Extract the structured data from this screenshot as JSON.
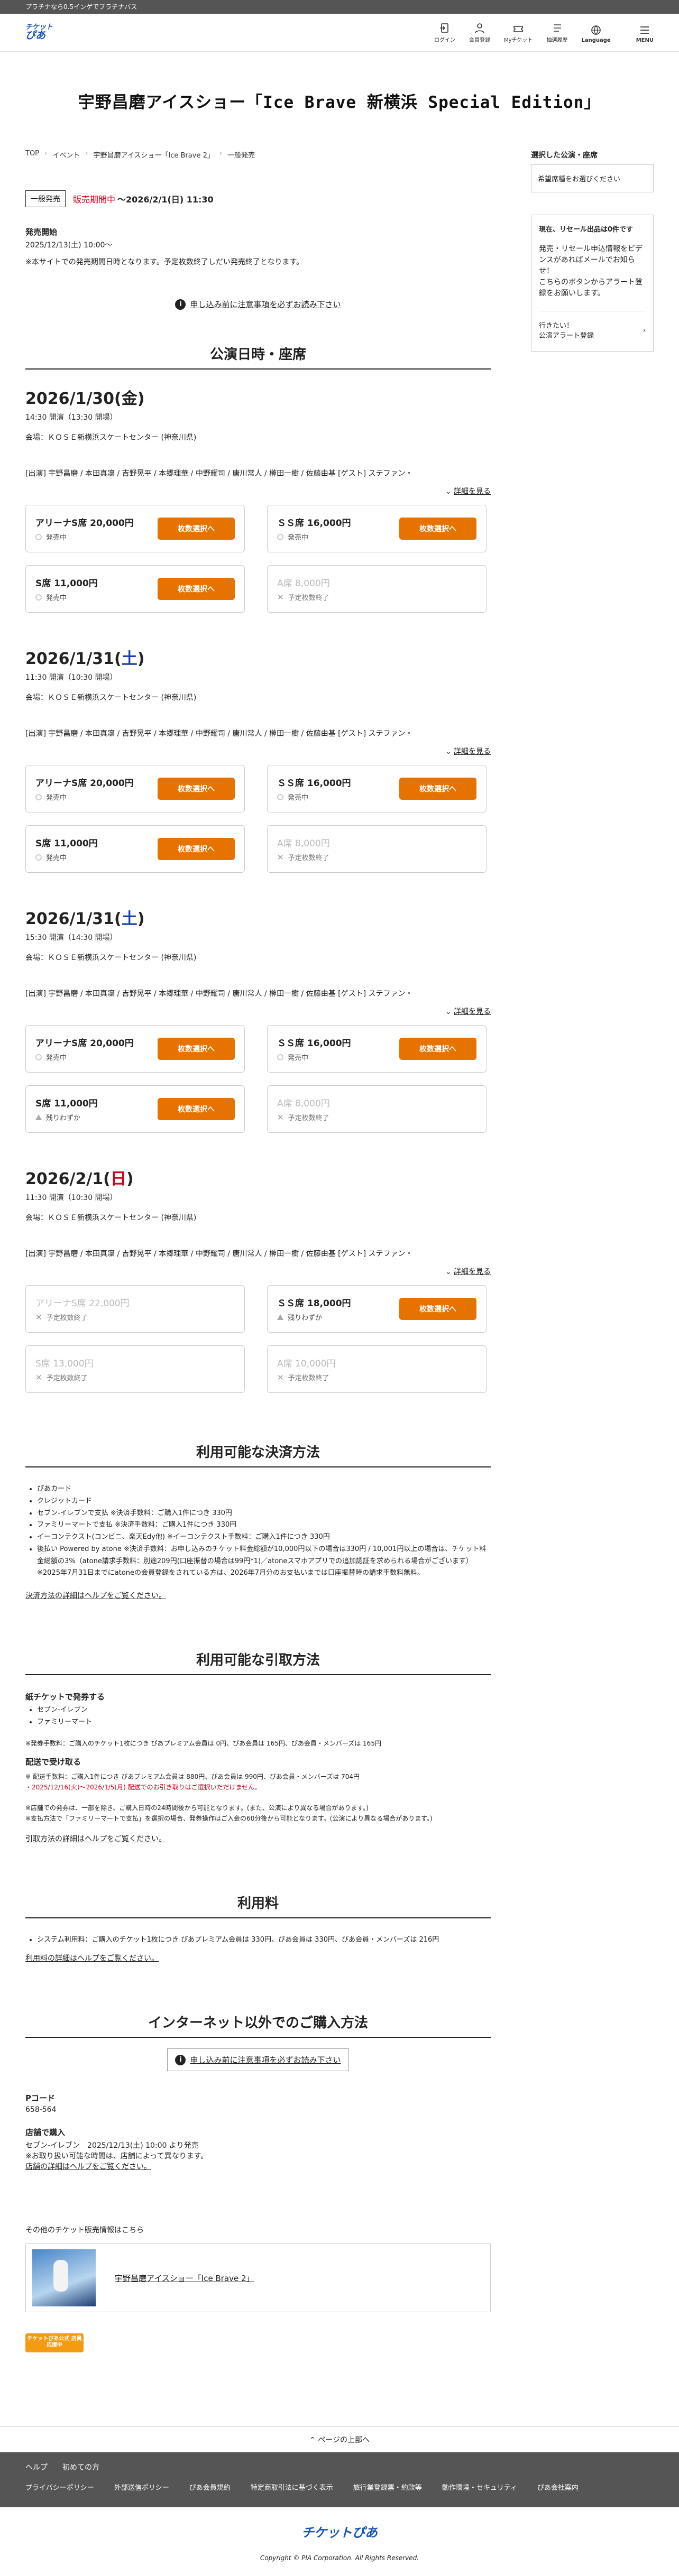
{
  "topbar": {
    "text": "プラチナなら0.5インゲでプラチナパス"
  },
  "header": {
    "logo_line1": "チケット",
    "logo_line2": "ぴあ",
    "nav": [
      {
        "label": "ログイン",
        "icon": "login-icon"
      },
      {
        "label": "会員登録",
        "icon": "user-icon"
      },
      {
        "label": "Myチケット",
        "icon": "ticket-icon"
      },
      {
        "label": "抽選履歴",
        "icon": "history-icon"
      },
      {
        "label": "Language",
        "icon": "globe-icon"
      }
    ],
    "menu_label": "MENU"
  },
  "event": {
    "title": "宇野昌磨アイスショー「Ice Brave 新横浜 Special Edition」"
  },
  "breadcrumb": [
    "TOP",
    "イベント",
    "宇野昌磨アイスショー「Ice Brave 2」",
    "一般発売"
  ],
  "status": {
    "badge": "一般発売",
    "state": "販売期間中",
    "period": "〜2026/2/1(日) 11:30"
  },
  "sale_start": {
    "heading": "発売開始",
    "value": "2025/12/13(土) 10:00〜"
  },
  "note": "※本サイトでの発売期間日時となります。予定枚数終了しだい発売終了となります。",
  "notice_link": "申し込み前に注意事項を必ずお読み下さい",
  "performances_title": "公演日時・座席",
  "detail_link_label": "詳細を見る",
  "performances": [
    {
      "date": "2026/1/30",
      "dow": "金",
      "dow_color": "normal",
      "time": "14:30 開演（13:30 開場）",
      "venue": "会場：ＫＯＳＥ新横浜スケートセンター (神奈川県)",
      "cast": "[出演] 宇野昌磨 / 本田真凜 / 吉野晃平 / 本郷理華 / 中野耀司 / 唐川常人 / 榊田一樹 / 佐藤由基 [ゲスト] ステファン・",
      "seats": [
        {
          "name": "アリーナS席 20,000円",
          "state": "発売中",
          "mark": "dot",
          "button": "枚数選択へ",
          "available": true
        },
        {
          "name": "ＳＳ席 16,000円",
          "state": "発売中",
          "mark": "dot",
          "button": "枚数選択へ",
          "available": true
        },
        {
          "name": "S席 11,000円",
          "state": "発売中",
          "mark": "dot",
          "button": "枚数選択へ",
          "available": true
        },
        {
          "name": "A席 8,000円",
          "state": "予定枚数終了",
          "mark": "x",
          "button": "",
          "available": false
        }
      ]
    },
    {
      "date": "2026/1/31",
      "dow": "土",
      "dow_color": "sat",
      "time": "11:30 開演（10:30 開場）",
      "venue": "会場：ＫＯＳＥ新横浜スケートセンター (神奈川県)",
      "cast": "[出演] 宇野昌磨 / 本田真凜 / 吉野晃平 / 本郷理華 / 中野耀司 / 唐川常人 / 榊田一樹 / 佐藤由基 [ゲスト] ステファン・",
      "seats": [
        {
          "name": "アリーナS席 20,000円",
          "state": "発売中",
          "mark": "dot",
          "button": "枚数選択へ",
          "available": true
        },
        {
          "name": "ＳＳ席 16,000円",
          "state": "発売中",
          "mark": "dot",
          "button": "枚数選択へ",
          "available": true
        },
        {
          "name": "S席 11,000円",
          "state": "発売中",
          "mark": "dot",
          "button": "枚数選択へ",
          "available": true
        },
        {
          "name": "A席 8,000円",
          "state": "予定枚数終了",
          "mark": "x",
          "button": "",
          "available": false
        }
      ]
    },
    {
      "date": "2026/1/31",
      "dow": "土",
      "dow_color": "sat",
      "time": "15:30 開演（14:30 開場）",
      "venue": "会場：ＫＯＳＥ新横浜スケートセンター (神奈川県)",
      "cast": "[出演] 宇野昌磨 / 本田真凜 / 吉野晃平 / 本郷理華 / 中野耀司 / 唐川常人 / 榊田一樹 / 佐藤由基 [ゲスト] ステファン・",
      "seats": [
        {
          "name": "アリーナS席 20,000円",
          "state": "発売中",
          "mark": "dot",
          "button": "枚数選択へ",
          "available": true
        },
        {
          "name": "ＳＳ席 16,000円",
          "state": "発売中",
          "mark": "dot",
          "button": "枚数選択へ",
          "available": true
        },
        {
          "name": "S席 11,000円",
          "state": "残りわずか",
          "mark": "tri",
          "button": "枚数選択へ",
          "available": true
        },
        {
          "name": "A席 8,000円",
          "state": "予定枚数終了",
          "mark": "x",
          "button": "",
          "available": false
        }
      ]
    },
    {
      "date": "2026/2/1",
      "dow": "日",
      "dow_color": "sun",
      "time": "11:30 開演（10:30 開場）",
      "venue": "会場：ＫＯＳＥ新横浜スケートセンター (神奈川県)",
      "cast": "[出演] 宇野昌磨 / 本田真凜 / 吉野晃平 / 本郷理華 / 中野耀司 / 唐川常人 / 榊田一樹 / 佐藤由基 [ゲスト] ステファン・",
      "seats": [
        {
          "name": "アリーナS席 22,000円",
          "state": "予定枚数終了",
          "mark": "x",
          "button": "",
          "available": false
        },
        {
          "name": "ＳＳ席 18,000円",
          "state": "残りわずか",
          "mark": "tri",
          "button": "枚数選択へ",
          "available": true
        },
        {
          "name": "S席 13,000円",
          "state": "予定枚数終了",
          "mark": "x",
          "button": "",
          "available": false
        },
        {
          "name": "A席 10,000円",
          "state": "予定枚数終了",
          "mark": "x",
          "button": "",
          "available": false
        }
      ]
    }
  ],
  "payment": {
    "title": "利用可能な決済方法",
    "items": [
      "ぴあカード",
      "クレジットカード",
      "セブン-イレブンで支払 ※決済手数料：ご購入1件につき 330円",
      "ファミリーマートで支払 ※決済手数料：ご購入1件につき 330円",
      "イーコンテクスト(コンビニ、楽天Edy他) ※イーコンテクスト手数料：ご購入1件につき 330円",
      "後払い Powered by atone ※決済手数料：お申し込みのチケット料金総額が10,000円以下の場合は330円 / 10,001円以上の場合は、チケット料金総額の3%（atone請求手数料：別途209円(口座振替の場合は99円*1)／atoneスマホアプリでの追加認証を求められる場合がございます） ※2025年7月31日までにatoneの会員登録をされている方は、2026年7月分のお支払いまでは口座振替時の請求手数料無料。"
    ],
    "link": "決済方法の詳細はヘルプをご覧ください。"
  },
  "delivery": {
    "title": "利用可能な引取方法",
    "paper_heading": "紙チケットで発券する",
    "paper_items": [
      "セブン-イレブン",
      "ファミリーマート"
    ],
    "paper_fee": "※発券手数料：ご購入のチケット1枚につき ぴあプレミアム会員は 0円、ぴあ会員は 165円、ぴあ会員・メンバーズは 165円",
    "ship_heading": "配送で受け取る",
    "ship_fee": "※ 配送手数料：ご購入1件につき ぴあプレミアム会員は 880円、ぴあ会員は 990円、ぴあ会員・メンバーズは 704円",
    "ship_red": "・2025/12/16(火)〜2026/1/5(月) 配送でのお引き取りはご選択いただけません。",
    "store_note_1": "※店舗での発券は、一部を除き、ご購入日時の24時間後から可能となります。(また、公演により異なる場合があります。)",
    "store_note_2": "※支払方法で「ファミリーマートで支払」を選択の場合、発券操作はご入金の60分後から可能となります。(公演により異なる場合があります。)",
    "link": "引取方法の詳細はヘルプをご覧ください。"
  },
  "fee": {
    "title": "利用料",
    "item": "システム利用料：ご購入のチケット1枚につき ぴあプレミアム会員は 330円、ぴあ会員は 330円、ぴあ会員・メンバーズは 216円",
    "link": "利用料の詳細はヘルプをご覧ください。"
  },
  "offline": {
    "title": "インターネット以外でのご購入方法",
    "notice": "申し込み前に注意事項を必ずお読み下さい",
    "pcode_heading": "Pコード",
    "pcode": "658-564",
    "store_heading": "店舗で購入",
    "store_line1": "セブン-イレブン　2025/12/13(土) 10:00 より発売",
    "store_line2": "※お取り扱い可能な時間は、店舗によって異なります。",
    "store_link": "店舗の詳細はヘルプをご覧ください。"
  },
  "other_sales": {
    "heading": "その他のチケット販売情報はこちら",
    "item_title": "宇野昌磨アイスショー「Ice Brave 2」"
  },
  "badge_text": "チケットぴあ公式 店員応援中",
  "page_top": "ページの上部へ",
  "footer": {
    "row1": [
      "ヘルプ",
      "初めての方"
    ],
    "row2": [
      "プライバシーポリシー",
      "外部送信ポリシー",
      "ぴあ会員規約",
      "特定商取引法に基づく表示",
      "旅行業登録票・約款等",
      "動作環境・セキュリティ",
      "ぴあ会社案内"
    ]
  },
  "bottom": {
    "logo": "チケットぴあ",
    "copyright": "Copyright © PIA Corporation. All Rights Reserved."
  },
  "sidebar": {
    "selected_heading": "選択した公演・座席",
    "selected_placeholder": "希望席種をお選びください",
    "alert_heading": "現在、リセール出品は0件です",
    "alert_body": "発売・リセール申込情報をビデンスがあればメールでお知らせ！\nこちらのボタンからアラート登録をお願いします。",
    "alert_link_line1": "行きたい！",
    "alert_link_line2": "公演アラート登録"
  },
  "colors": {
    "accent": "#e67300",
    "status_red": "#d0021b",
    "brand_blue": "#1a56b3",
    "saturday": "#1a3fb0",
    "sunday": "#d0021b"
  }
}
